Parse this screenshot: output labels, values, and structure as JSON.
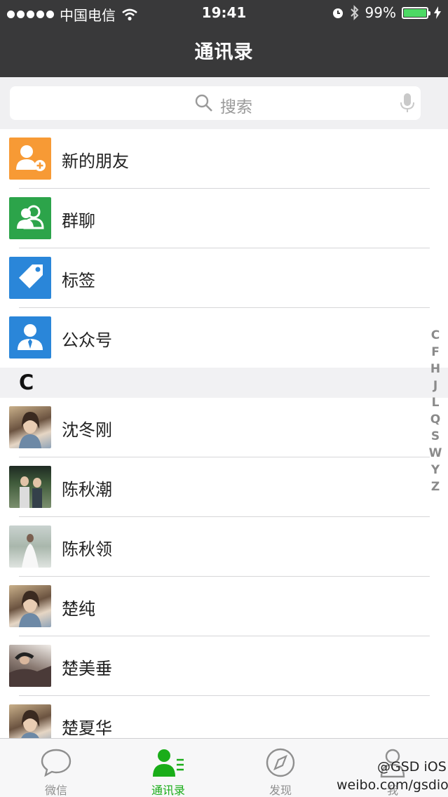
{
  "status_bar": {
    "carrier": "中国电信",
    "time": "19:41",
    "battery_percent": "99%",
    "battery_level": 0.99
  },
  "nav": {
    "title": "通讯录"
  },
  "search": {
    "placeholder": "搜索"
  },
  "functions": [
    {
      "label": "新的朋友",
      "icon": "add-friend-icon",
      "color": "#f79a35"
    },
    {
      "label": "群聊",
      "icon": "group-chat-icon",
      "color": "#2ca44a"
    },
    {
      "label": "标签",
      "icon": "tag-icon",
      "color": "#2a86d9"
    },
    {
      "label": "公众号",
      "icon": "official-account-icon",
      "color": "#2a86d9"
    }
  ],
  "section_header": "C",
  "contacts": [
    {
      "name": "沈冬刚"
    },
    {
      "name": "陈秋潮"
    },
    {
      "name": "陈秋领"
    },
    {
      "name": "楚纯"
    },
    {
      "name": "楚美垂"
    },
    {
      "name": "楚夏华"
    }
  ],
  "index_letters": [
    "C",
    "F",
    "H",
    "J",
    "L",
    "Q",
    "S",
    "W",
    "Y",
    "Z"
  ],
  "tabs": [
    {
      "label": "微信",
      "icon": "chat-bubble-icon",
      "active": false
    },
    {
      "label": "通讯录",
      "icon": "contacts-icon",
      "active": true
    },
    {
      "label": "发现",
      "icon": "compass-icon",
      "active": false
    },
    {
      "label": "我",
      "icon": "me-icon",
      "active": false
    }
  ],
  "watermark": {
    "line1": "@GSD iOS",
    "line2": "weibo.com/gsdios"
  },
  "colors": {
    "nav_bg": "#39393a",
    "accent": "#1aad19"
  }
}
